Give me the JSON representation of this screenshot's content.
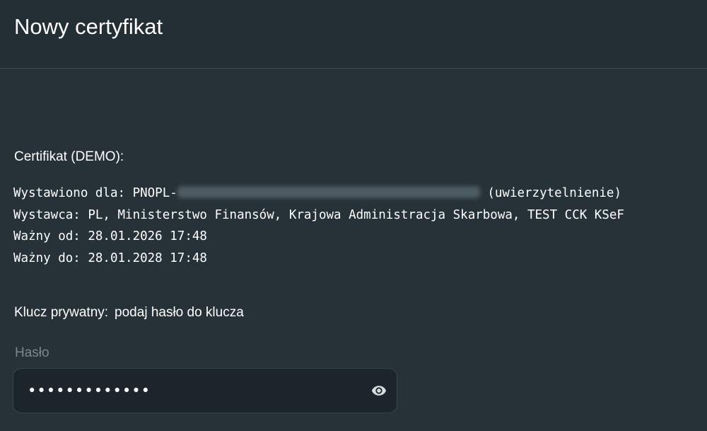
{
  "header": {
    "title": "Nowy certyfikat"
  },
  "certificate": {
    "label": "Certifikat (DEMO):",
    "issued_for_prefix": "Wystawiono dla: PNOPL-",
    "issued_for_suffix": " (uwierzytelnienie)",
    "issuer": "Wystawca: PL, Ministerstwo Finansów, Krajowa Administracja Skarbowa, TEST CCK KSeF",
    "valid_from": "Ważny od: 28.01.2026 17:48",
    "valid_to": "Ważny do: 28.01.2028 17:48"
  },
  "private_key": {
    "label": "Klucz prywatny:",
    "hint": "podaj hasło do klucza"
  },
  "password": {
    "label": "Hasło",
    "value": "•••••••••••••",
    "reveal_icon": "eye-icon"
  },
  "colors": {
    "background": "#263238",
    "header_background": "#242e35",
    "input_background": "#1b252b",
    "muted_text": "#7c878c"
  }
}
